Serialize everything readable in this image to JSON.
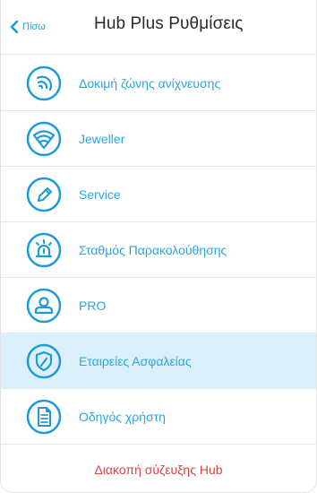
{
  "header": {
    "back_label": "Πίσω",
    "title": "Hub Plus Ρυθμίσεις"
  },
  "menu": {
    "items": [
      {
        "label": "Δοκιμή ζώνης ανίχνευσης",
        "icon": "signal-strength-icon",
        "selected": false
      },
      {
        "label": "Jeweller",
        "icon": "jeweller-wifi-icon",
        "selected": false
      },
      {
        "label": "Service",
        "icon": "pencil-icon",
        "selected": false
      },
      {
        "label": "Σταθμός Παρακολούθησης",
        "icon": "siren-icon",
        "selected": false
      },
      {
        "label": "PRO",
        "icon": "user-icon",
        "selected": false
      },
      {
        "label": "Εταιρείες Ασφαλείας",
        "icon": "shield-icon",
        "selected": true
      },
      {
        "label": "Οδηγός χρήστη",
        "icon": "document-icon",
        "selected": false
      }
    ]
  },
  "footer": {
    "unpair_label": "Διακοπή σύζευξης Hub"
  },
  "colors": {
    "accent": "#1d9bd6",
    "label": "#2aa6df",
    "selected_bg": "#dcf0fb",
    "danger": "#e0403d",
    "divider": "#e5e5e5"
  }
}
